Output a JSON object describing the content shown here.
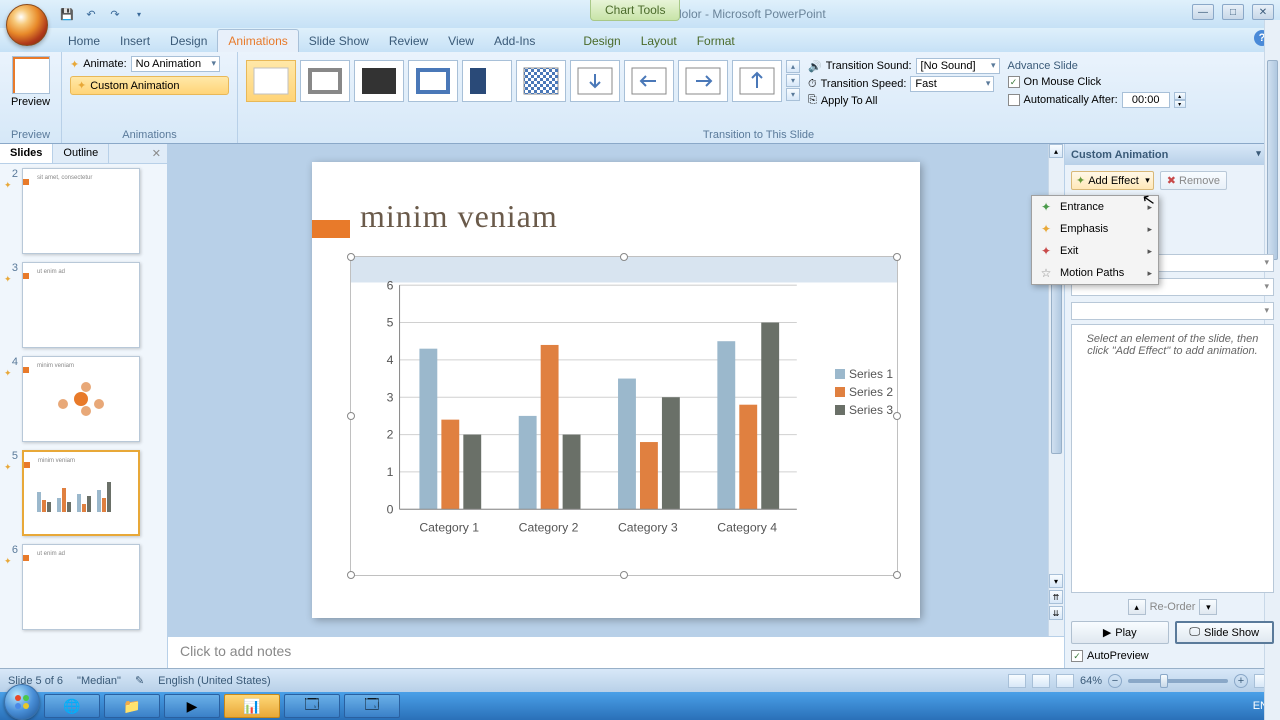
{
  "title": "Lorem ipsum dolor - Microsoft PowerPoint",
  "chart_tools_label": "Chart Tools",
  "tabs": [
    "Home",
    "Insert",
    "Design",
    "Animations",
    "Slide Show",
    "Review",
    "View",
    "Add-Ins"
  ],
  "context_tabs": [
    "Design",
    "Layout",
    "Format"
  ],
  "active_tab": "Animations",
  "ribbon": {
    "preview_label": "Preview",
    "preview_group": "Preview",
    "animate_label": "Animate:",
    "animate_value": "No Animation",
    "custom_animation_btn": "Custom Animation",
    "animations_group": "Animations",
    "transition_group": "Transition to This Slide",
    "transition_sound_label": "Transition Sound:",
    "transition_sound_value": "[No Sound]",
    "transition_speed_label": "Transition Speed:",
    "transition_speed_value": "Fast",
    "apply_all": "Apply To All",
    "advance_slide_label": "Advance Slide",
    "on_mouse_click": "On Mouse Click",
    "auto_after": "Automatically After:",
    "auto_after_value": "00:00"
  },
  "slides_panel": {
    "tab_slides": "Slides",
    "tab_outline": "Outline",
    "thumbs": [
      {
        "num": "2",
        "title": "sit amet, consectetur"
      },
      {
        "num": "3",
        "title": "ut enim ad"
      },
      {
        "num": "4",
        "title": "minim veniam"
      },
      {
        "num": "5",
        "title": "minim veniam"
      },
      {
        "num": "6",
        "title": "ut enim ad"
      }
    ]
  },
  "slide": {
    "title": "minim veniam"
  },
  "chart_data": {
    "type": "bar",
    "categories": [
      "Category 1",
      "Category 2",
      "Category 3",
      "Category 4"
    ],
    "series": [
      {
        "name": "Series 1",
        "values": [
          4.3,
          2.5,
          3.5,
          4.5
        ],
        "color": "#9bb8cc"
      },
      {
        "name": "Series 2",
        "values": [
          2.4,
          4.4,
          1.8,
          2.8
        ],
        "color": "#e08040"
      },
      {
        "name": "Series 3",
        "values": [
          2.0,
          2.0,
          3.0,
          5.0
        ],
        "color": "#6a7068"
      }
    ],
    "ylim": [
      0,
      6
    ],
    "yticks": [
      0,
      1,
      2,
      3,
      4,
      5,
      6
    ]
  },
  "notes_placeholder": "Click to add notes",
  "anim_pane": {
    "title": "Custom Animation",
    "add_effect": "Add Effect",
    "remove": "Remove",
    "menu": [
      "Entrance",
      "Emphasis",
      "Exit",
      "Motion Paths"
    ],
    "hint": "Select an element of the slide, then click \"Add Effect\" to add animation.",
    "reorder": "Re-Order",
    "play": "Play",
    "slideshow": "Slide Show",
    "autopreview": "AutoPreview"
  },
  "status": {
    "slide_info": "Slide 5 of 6",
    "theme": "\"Median\"",
    "language": "English (United States)",
    "zoom": "64%"
  },
  "taskbar_lang": "EN"
}
